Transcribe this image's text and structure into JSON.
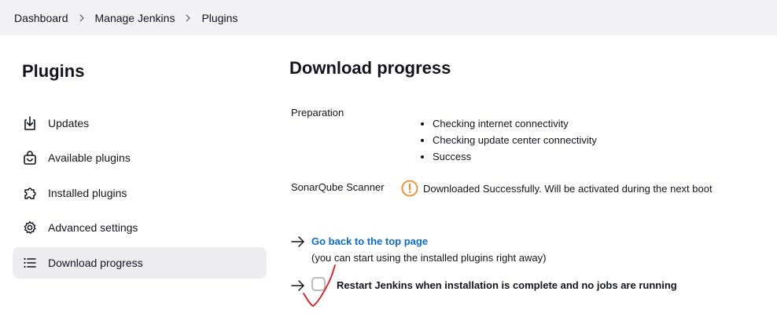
{
  "breadcrumb": {
    "items": [
      "Dashboard",
      "Manage Jenkins",
      "Plugins"
    ]
  },
  "sidebar": {
    "title": "Plugins",
    "items": [
      {
        "label": "Updates",
        "icon": "download-icon"
      },
      {
        "label": "Available plugins",
        "icon": "shopping-bag-icon"
      },
      {
        "label": "Installed plugins",
        "icon": "puzzle-piece-icon"
      },
      {
        "label": "Advanced settings",
        "icon": "gear-icon"
      },
      {
        "label": "Download progress",
        "icon": "list-icon",
        "active": true
      }
    ]
  },
  "main": {
    "title": "Download progress",
    "preparation": {
      "label": "Preparation",
      "steps": [
        "Checking internet connectivity",
        "Checking update center connectivity",
        "Success"
      ]
    },
    "plugin_row": {
      "name": "SonarQube Scanner",
      "status_icon": "warning-circle-icon",
      "status_text": "Downloaded Successfully. Will be activated during the next boot"
    },
    "back_link": {
      "label": "Go back to the top page",
      "note": "(you can start using the installed plugins right away)"
    },
    "restart": {
      "label": "Restart Jenkins when installation is complete and no jobs are running",
      "checked": false
    }
  },
  "colors": {
    "link": "#0b6bd3",
    "warning": "#f08a24",
    "breadcrumb_bg": "#f2f2f4",
    "active_item_bg": "#ededf0",
    "annotation": "#e0161b"
  }
}
